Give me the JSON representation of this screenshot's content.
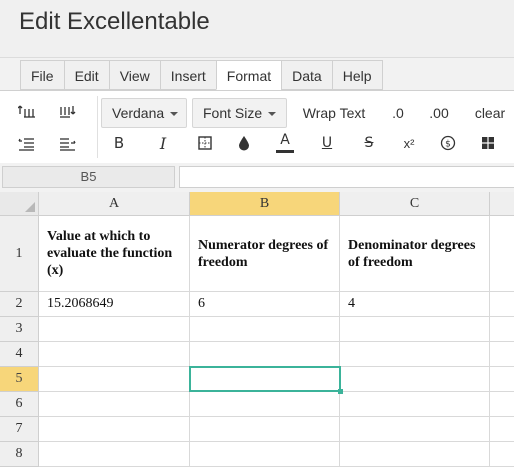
{
  "app": {
    "title": "Edit Excellentable"
  },
  "menu": [
    "File",
    "Edit",
    "View",
    "Insert",
    "Format",
    "Data",
    "Help"
  ],
  "menu_active": "Format",
  "toolbar": {
    "font": "Verdana",
    "font_size": "Font Size",
    "wrap_text": "Wrap Text",
    "dec_decrease": ".0",
    "dec_increase": ".00",
    "clear": "clear",
    "bold": "B",
    "italic": "I",
    "font_color": "A",
    "underline": "U",
    "strike": "S",
    "superscript": "x²"
  },
  "formula_bar": {
    "name_box": "B5",
    "value": ""
  },
  "sheet": {
    "columns": [
      "A",
      "B",
      "C"
    ],
    "rows": [
      "1",
      "2",
      "3",
      "4",
      "5",
      "6",
      "7",
      "8"
    ],
    "selected_cell": "B5",
    "cells": {
      "A1": "Value at which to evaluate the function (x)",
      "B1": "Numerator degrees of freedom",
      "C1": "Denominator degrees of freedom",
      "A2": "15.2068649",
      "B2": "6",
      "C2": "4"
    }
  },
  "colors": {
    "selection": "#3bb39a",
    "header_selected": "#f7d67a"
  }
}
